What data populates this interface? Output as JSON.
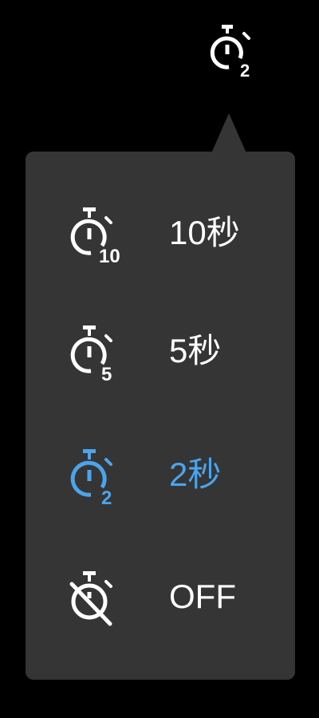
{
  "header": {
    "current_timer_icon": "timer-2-icon",
    "current_timer_badge": "2"
  },
  "menu": {
    "options": [
      {
        "label": "10秒",
        "badge": "10",
        "icon": "timer-10-icon",
        "selected": false
      },
      {
        "label": "5秒",
        "badge": "5",
        "icon": "timer-5-icon",
        "selected": false
      },
      {
        "label": "2秒",
        "badge": "2",
        "icon": "timer-2-icon",
        "selected": true
      },
      {
        "label": "OFF",
        "badge": "",
        "icon": "timer-off-icon",
        "selected": false
      }
    ]
  },
  "colors": {
    "background": "#000000",
    "panel": "#353535",
    "text": "#ffffff",
    "accent": "#4ca5ec"
  }
}
